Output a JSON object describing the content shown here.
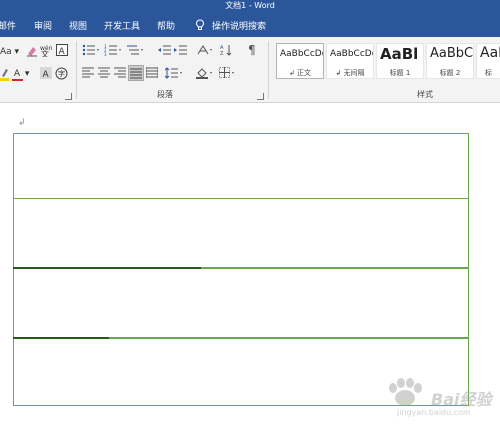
{
  "window": {
    "title": "文档1 - Word"
  },
  "menu": {
    "tabs": [
      {
        "label": "邮件"
      },
      {
        "label": "审阅"
      },
      {
        "label": "视图"
      },
      {
        "label": "开发工具"
      },
      {
        "label": "帮助"
      }
    ],
    "tell_me": "操作说明搜索"
  },
  "ribbon": {
    "font_group": {
      "aa_label": "Aa",
      "font_color_label": "A",
      "char_label": "字"
    },
    "paragraph_group": {
      "label": "段落"
    },
    "styles_group": {
      "label": "样式",
      "styles": [
        {
          "sample": "AaBbCcDd",
          "name": "↲ 正文",
          "selected": true
        },
        {
          "sample": "AaBbCcDd",
          "name": "↲ 无间隔",
          "selected": false
        },
        {
          "sample": "AaBl",
          "name": "标题 1",
          "selected": false
        },
        {
          "sample": "AaBbC",
          "name": "标题 2",
          "selected": false
        },
        {
          "sample": "AaI",
          "name": "标",
          "selected": false
        }
      ]
    }
  },
  "document": {
    "paragraph_mark": "↲",
    "table": {
      "rows": 4
    }
  },
  "watermark": {
    "text": "Bai经验",
    "url": "jingyan.baidu.com"
  },
  "colors": {
    "titlebar": "#2b579a",
    "ribbon": "#f3f3f3",
    "table_border": "#6aa84f"
  }
}
